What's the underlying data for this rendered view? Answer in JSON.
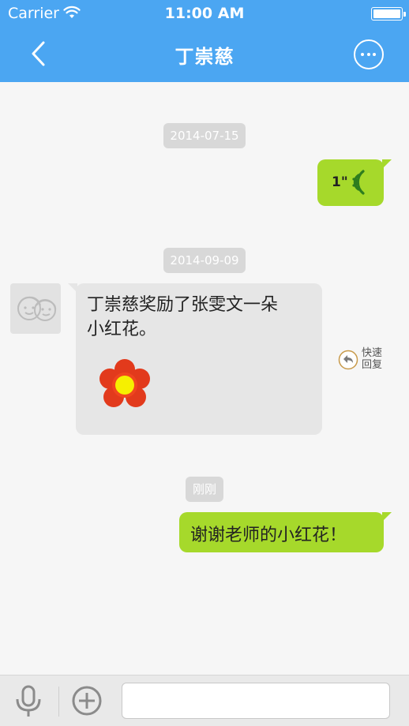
{
  "status_bar": {
    "carrier": "Carrier",
    "time": "11:00 AM"
  },
  "nav": {
    "title": "丁崇慈",
    "back_icon": "chevron-left-icon",
    "more_icon": "more-options-icon"
  },
  "messages": [
    {
      "type": "timestamp",
      "text": "2014-07-15"
    },
    {
      "type": "voice",
      "direction": "out",
      "duration": "1\""
    },
    {
      "type": "timestamp",
      "text": "2014-09-09"
    },
    {
      "type": "text",
      "direction": "in",
      "line1": "丁崇慈奖励了张雯文一朵",
      "line2": "小红花。",
      "icon": "red-flower-icon"
    },
    {
      "type": "timestamp",
      "text": "刚刚"
    },
    {
      "type": "text",
      "direction": "out",
      "text": "谢谢老师的小红花！"
    }
  ],
  "quick_reply": {
    "line1": "快速",
    "line2": "回复"
  },
  "input_bar": {
    "mic_icon": "microphone-icon",
    "plus_icon": "plus-circle-icon",
    "input_value": "",
    "input_placeholder": ""
  },
  "colors": {
    "header": "#4ba6f2",
    "outgoing_bubble": "#a6d92b",
    "incoming_bubble": "#e6e6e6",
    "timestamp_bg": "#d8d8d8"
  }
}
